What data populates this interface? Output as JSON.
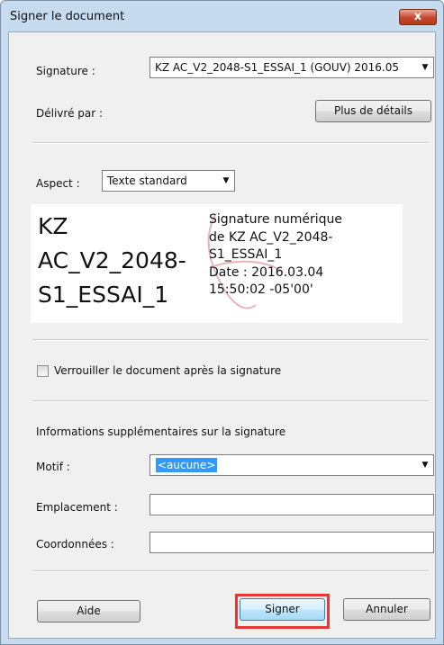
{
  "window": {
    "title": "Signer le document",
    "close_label": "x"
  },
  "signature": {
    "label": "Signature :",
    "selected": "KZ AC_V2_2048-S1_ESSAI_1 (GOUV) 2016.05",
    "delivered_label": "Délivré par :",
    "details_button": "Plus de détails"
  },
  "aspect": {
    "label": "Aspect :",
    "selected": "Texte standard"
  },
  "preview": {
    "name_lines": [
      "KZ",
      "AC_V2_2048-",
      "S1_ESSAI_1"
    ],
    "detail_lines": [
      "Signature numérique",
      "de KZ AC_V2_2048-",
      "S1_ESSAI_1",
      "Date : 2016.03.04",
      "15:50:02 -05'00'"
    ]
  },
  "lock": {
    "label": "Verrouiller le document après la signature",
    "checked": false
  },
  "info": {
    "heading": "Informations supplémentaires sur la signature",
    "motif_label": "Motif :",
    "motif_value": "<aucune>",
    "location_label": "Emplacement :",
    "location_value": "",
    "contact_label": "Coordonnées :",
    "contact_value": ""
  },
  "buttons": {
    "help": "Aide",
    "sign": "Signer",
    "cancel": "Annuler"
  },
  "colors": {
    "highlight": "#3399ff",
    "sign_outline": "#e53935",
    "watermark": "#e8b4b4"
  }
}
